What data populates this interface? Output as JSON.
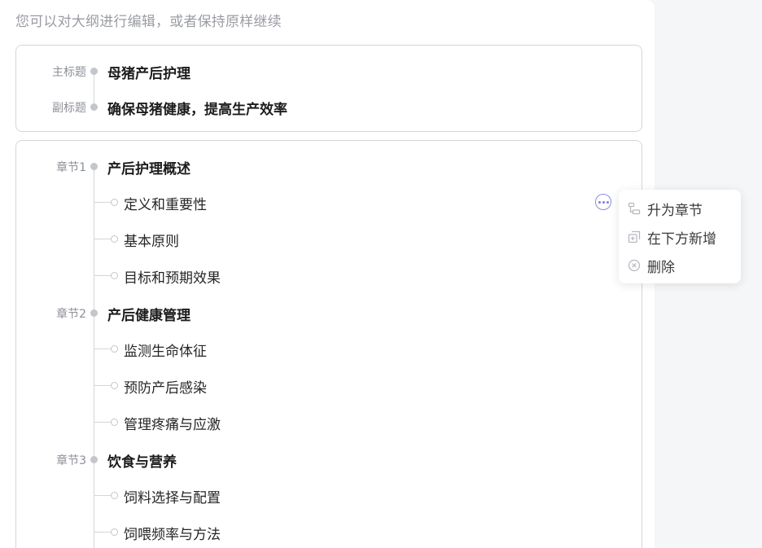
{
  "hint": "您可以对大纲进行编辑，或者保持原样继续",
  "title_card": {
    "main_label": "主标题",
    "main_value": "母猪产后护理",
    "sub_label": "副标题",
    "sub_value": "确保母猪健康，提高生产效率"
  },
  "chapters": [
    {
      "label": "章节1",
      "title": "产后护理概述",
      "items": [
        "定义和重要性",
        "基本原则",
        "目标和预期效果"
      ]
    },
    {
      "label": "章节2",
      "title": "产后健康管理",
      "items": [
        "监测生命体征",
        "预防产后感染",
        "管理疼痛与应激"
      ]
    },
    {
      "label": "章节3",
      "title": "饮食与营养",
      "items": [
        "饲料选择与配置",
        "饲喂频率与方法"
      ]
    }
  ],
  "context_menu": {
    "promote": "升为章节",
    "add_below": "在下方新增",
    "delete": "删除"
  },
  "colors": {
    "accent": "#7c80d6",
    "border": "#d4d6da",
    "muted_text": "#9a9ca3"
  }
}
